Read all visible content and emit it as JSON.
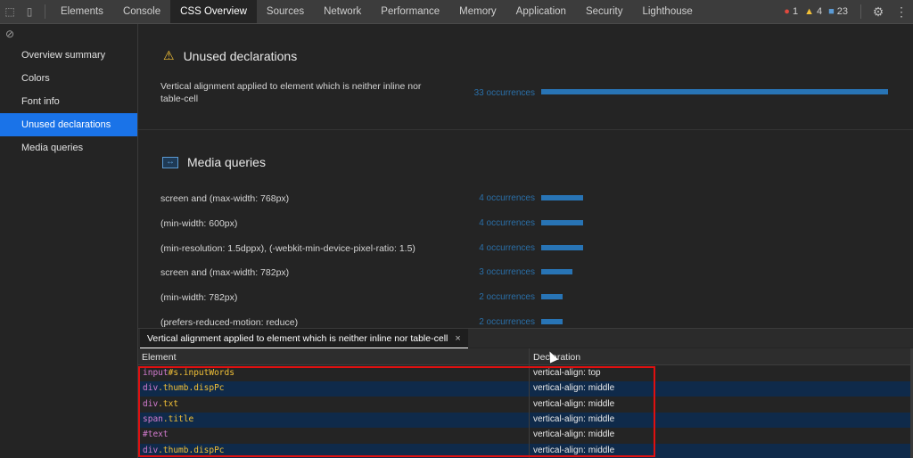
{
  "toolbar": {
    "tabs": [
      "Elements",
      "Console",
      "CSS Overview",
      "Sources",
      "Network",
      "Performance",
      "Memory",
      "Application",
      "Security",
      "Lighthouse"
    ],
    "active_tab": "CSS Overview",
    "error_count": "1",
    "warning_count": "4",
    "message_count": "23"
  },
  "sidebar": {
    "items": [
      {
        "label": "Overview summary"
      },
      {
        "label": "Colors"
      },
      {
        "label": "Font info"
      },
      {
        "label": "Unused declarations"
      },
      {
        "label": "Media queries"
      }
    ],
    "active": "Unused declarations"
  },
  "unused": {
    "title": "Unused declarations",
    "rows": [
      {
        "label": "Vertical alignment applied to element which is neither inline nor table-cell",
        "count": "33 occurrences",
        "value": 33
      }
    ]
  },
  "media": {
    "title": "Media queries",
    "rows": [
      {
        "label": "screen and (max-width: 768px)",
        "count": "4 occurrences",
        "value": 4
      },
      {
        "label": "(min-width: 600px)",
        "count": "4 occurrences",
        "value": 4
      },
      {
        "label": "(min-resolution: 1.5dppx), (-webkit-min-device-pixel-ratio: 1.5)",
        "count": "4 occurrences",
        "value": 4
      },
      {
        "label": "screen and (max-width: 782px)",
        "count": "3 occurrences",
        "value": 3
      },
      {
        "label": "(min-width: 782px)",
        "count": "2 occurrences",
        "value": 2
      },
      {
        "label": "(prefers-reduced-motion: reduce)",
        "count": "2 occurrences",
        "value": 2
      }
    ]
  },
  "drawer": {
    "tab_label": "Vertical alignment applied to element which is neither inline nor table-cell",
    "close": "×"
  },
  "grid": {
    "col_element": "Element",
    "col_declaration": "Declaration",
    "rows": [
      {
        "tag": "input",
        "sel": "#s.inputWords",
        "decl": "vertical-align: top"
      },
      {
        "tag": "div",
        "sel": ".thumb.dispPc",
        "decl": "vertical-align: middle"
      },
      {
        "tag": "div",
        "sel": ".txt",
        "decl": "vertical-align: middle"
      },
      {
        "tag": "span",
        "sel": ".title",
        "decl": "vertical-align: middle"
      },
      {
        "tag": "",
        "sel": "#text",
        "decl": "vertical-align: middle"
      },
      {
        "tag": "div",
        "sel": ".thumb.dispPc",
        "decl": "vertical-align: middle"
      }
    ]
  },
  "icons": {
    "inspect": "inspect-element-icon",
    "device": "device-toggle-icon",
    "clear": "clear-icon",
    "warning": "warning-icon",
    "media": "media-queries-icon",
    "settings": "gear-icon",
    "more": "more-icon"
  },
  "colors": {
    "accent": "#1a73e8",
    "bar": "#2874b5",
    "highlight": "#e01010"
  }
}
